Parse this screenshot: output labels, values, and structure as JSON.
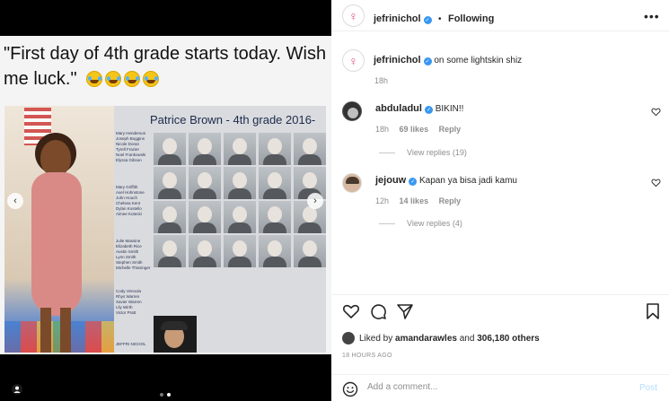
{
  "post": {
    "caption_text": "\"First day of 4th grade starts today. Wish me luck.\"",
    "yearbook_title": "Patrice Brown - 4th grade 2016-",
    "yearbook_names_group1": [
      "Mary Henderson",
      "Joseph Boggins",
      "Nicole Doran",
      "Tyrell Frazier",
      "Noel Frankowski",
      "Elyssa Gibson"
    ],
    "yearbook_names_group2": [
      "Mary Griffith",
      "Axel Hohnstone",
      "John Houch",
      "Chelsea Kent",
      "Dylan Kostello",
      "Aimee Kotecki"
    ],
    "yearbook_names_group3": [
      "Julie Massine",
      "Elizabeth Rice",
      "Austin Smith",
      "Lynn Smith",
      "Stephen Smith",
      "Michelle Thissinger"
    ],
    "yearbook_names_group4": [
      "Cody Vennola",
      "Rhys Warren",
      "Xavier Warren",
      "Lily Wirth",
      "Victor Pratt"
    ],
    "yearbook_signature": "JEFFRI NICHOL",
    "carousel": {
      "count": 2,
      "active_index": 1
    }
  },
  "header": {
    "username": "jefrinichol",
    "separator": "•",
    "follow_label": "Following",
    "more_label": "•••"
  },
  "owner_comment": {
    "username": "jefrinichol",
    "text": "on some lightskin shiz",
    "time": "18h"
  },
  "comments": [
    {
      "username": "abduladul",
      "text": "BIKIN!!",
      "time": "18h",
      "likes": "69 likes",
      "reply_label": "Reply",
      "view_replies": "View replies (19)"
    },
    {
      "username": "jejouw",
      "text": "Kapan ya bisa jadi kamu",
      "time": "12h",
      "likes": "14 likes",
      "reply_label": "Reply",
      "view_replies": "View replies (4)"
    }
  ],
  "likes": {
    "prefix": "Liked by",
    "user": "amandarawles",
    "conjunction": "and",
    "others": "306,180 others"
  },
  "posted_ago": "18 HOURS AGO",
  "comment_box": {
    "placeholder": "Add a comment...",
    "post_label": "Post"
  }
}
